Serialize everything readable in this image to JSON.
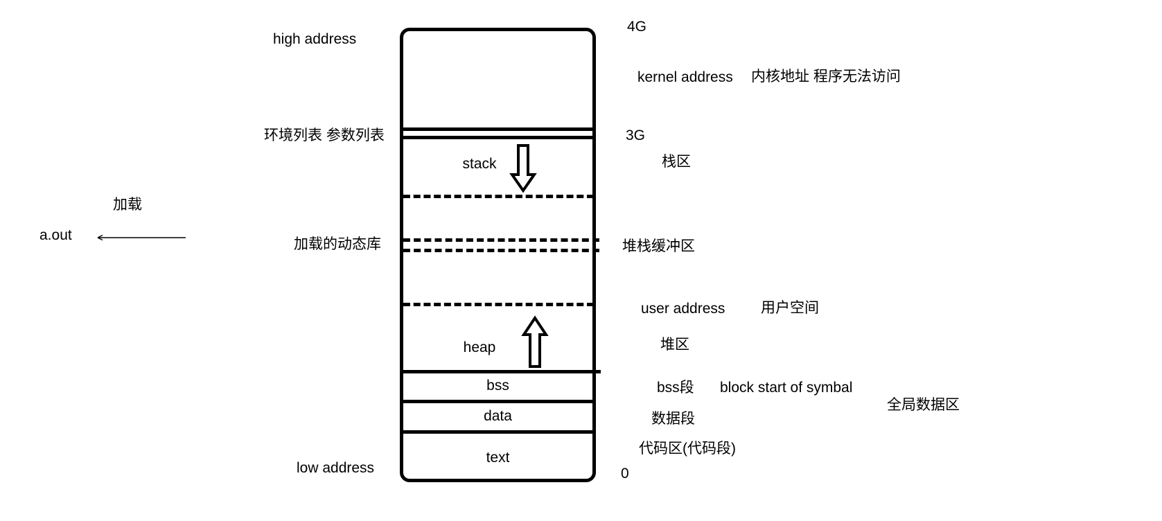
{
  "diagram": {
    "title_note": "Linux process virtual memory layout diagram",
    "left_side": {
      "high_address": "high address",
      "env_arg_list": "环境列表  参数列表",
      "loaded_dynamic_lib": "加载的动态库",
      "low_address": "low address",
      "load_label": "加载",
      "executable": "a.out"
    },
    "memory_segments": [
      {
        "name": "kernel-region",
        "label": ""
      },
      {
        "name": "stack",
        "label": "stack"
      },
      {
        "name": "heap",
        "label": "heap"
      },
      {
        "name": "bss",
        "label": "bss"
      },
      {
        "name": "data",
        "label": "data"
      },
      {
        "name": "text",
        "label": "text"
      }
    ],
    "right_side": {
      "addr_4g": "4G",
      "addr_3g": "3G",
      "addr_0": "0",
      "kernel_address_en": "kernel address",
      "kernel_address_cn": "内核地址  程序无法访问",
      "stack_zone_cn": "栈区",
      "stack_buffer_cn": "堆栈缓冲区",
      "user_address_en": "user address",
      "user_address_cn": "用户空间",
      "heap_zone_cn": "堆区",
      "bss_cn": "bss段",
      "bss_en": "block start of symbal",
      "global_data_cn": "全局数据区",
      "data_cn": "数据段",
      "text_cn": "代码区(代码段)"
    },
    "colors": {
      "stroke": "#000000",
      "background": "#ffffff"
    }
  }
}
